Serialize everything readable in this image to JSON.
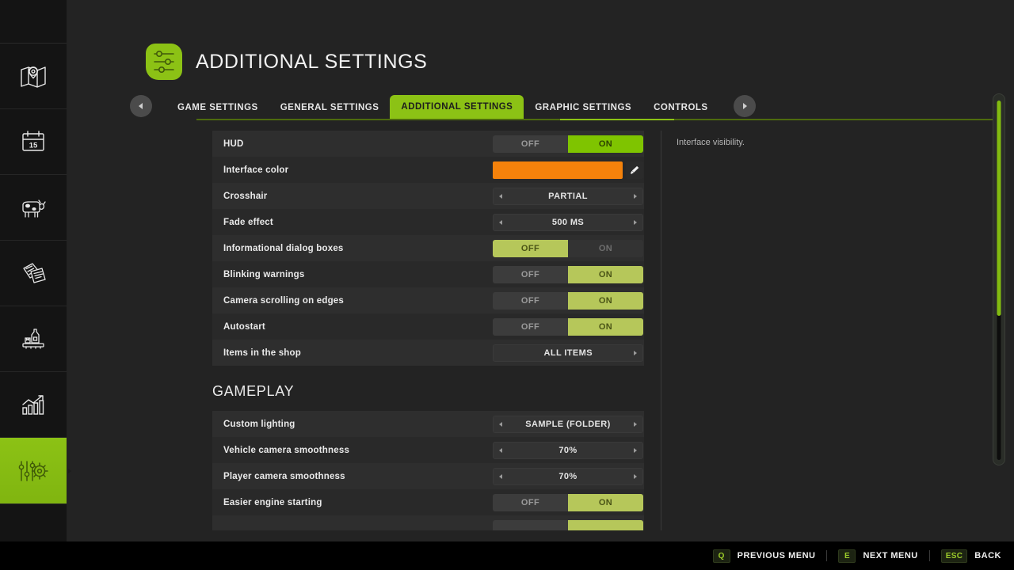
{
  "sidebar": {
    "items": [
      {
        "icon": "map-icon",
        "name": "sidebar-item-map",
        "active": false
      },
      {
        "icon": "calendar-icon",
        "name": "sidebar-item-calendar",
        "active": false,
        "day": "15"
      },
      {
        "icon": "animals-cow-icon",
        "name": "sidebar-item-animals",
        "active": false
      },
      {
        "icon": "contracts-documents-icon",
        "name": "sidebar-item-contracts",
        "active": false
      },
      {
        "icon": "production-factory-icon",
        "name": "sidebar-item-production",
        "active": false
      },
      {
        "icon": "statistics-chart-icon",
        "name": "sidebar-item-statistics",
        "active": false
      },
      {
        "icon": "settings-sliders-gear-icon",
        "name": "sidebar-item-settings",
        "active": true
      }
    ]
  },
  "header": {
    "title": "ADDITIONAL SETTINGS",
    "icon": "settings-sliders-icon"
  },
  "tabs": {
    "prev_arrow_icon": "chevron-left-icon",
    "next_arrow_icon": "chevron-right-icon",
    "items": [
      {
        "label": "GAME SETTINGS",
        "active": false
      },
      {
        "label": "GENERAL SETTINGS",
        "active": false
      },
      {
        "label": "ADDITIONAL SETTINGS",
        "active": true
      },
      {
        "label": "GRAPHIC SETTINGS",
        "active": false
      },
      {
        "label": "CONTROLS",
        "active": false
      }
    ]
  },
  "settings": {
    "rows": [
      {
        "label": "HUD",
        "type": "toggle",
        "off_label": "OFF",
        "on_label": "ON",
        "value": "ON",
        "highlighted": true
      },
      {
        "label": "Interface color",
        "type": "color",
        "color": "#f5820b",
        "picker_icon": "color-picker-brush-icon"
      },
      {
        "label": "Crosshair",
        "type": "spinner",
        "value": "PARTIAL",
        "has_prev": true,
        "has_next": true
      },
      {
        "label": "Fade effect",
        "type": "spinner",
        "value": "500 MS",
        "has_prev": true,
        "has_next": true
      },
      {
        "label": "Informational dialog boxes",
        "type": "toggle",
        "off_label": "OFF",
        "on_label": "ON",
        "value": "OFF",
        "highlighted": false
      },
      {
        "label": "Blinking warnings",
        "type": "toggle",
        "off_label": "OFF",
        "on_label": "ON",
        "value": "ON",
        "highlighted": false
      },
      {
        "label": "Camera scrolling on edges",
        "type": "toggle",
        "off_label": "OFF",
        "on_label": "ON",
        "value": "ON",
        "highlighted": false
      },
      {
        "label": "Autostart",
        "type": "toggle",
        "off_label": "OFF",
        "on_label": "ON",
        "value": "ON",
        "highlighted": false
      },
      {
        "label": "Items in the shop",
        "type": "spinner",
        "value": "ALL ITEMS",
        "has_prev": false,
        "has_next": true
      }
    ],
    "section_heading": "GAMEPLAY",
    "gameplay_rows": [
      {
        "label": "Custom lighting",
        "type": "spinner",
        "value": "SAMPLE (FOLDER)",
        "has_prev": true,
        "has_next": true
      },
      {
        "label": "Vehicle camera smoothness",
        "type": "spinner",
        "value": "70%",
        "has_prev": true,
        "has_next": true
      },
      {
        "label": "Player camera smoothness",
        "type": "spinner",
        "value": "70%",
        "has_prev": true,
        "has_next": true
      },
      {
        "label": "Easier engine starting",
        "type": "toggle",
        "off_label": "OFF",
        "on_label": "ON",
        "value": "ON",
        "highlighted": false
      },
      {
        "label": "",
        "type": "toggle",
        "off_label": "",
        "on_label": "",
        "value": "ON",
        "highlighted": false,
        "clipped": true
      }
    ]
  },
  "help": {
    "text": "Interface visibility."
  },
  "scrollbar": {
    "thumb_percent": 60
  },
  "bottom_bar": {
    "hints": [
      {
        "key": "Q",
        "label": "PREVIOUS MENU"
      },
      {
        "key": "E",
        "label": "NEXT MENU"
      },
      {
        "key": "ESC",
        "label": "BACK"
      }
    ]
  },
  "colors": {
    "accent_green": "#8cc215",
    "accent_green_bright": "#7fc400",
    "accent_olive": "#b6c75a",
    "interface_color": "#f5820b",
    "background": "#232323",
    "sidebar_background": "#141414",
    "row_background": "#2e2e2e"
  }
}
